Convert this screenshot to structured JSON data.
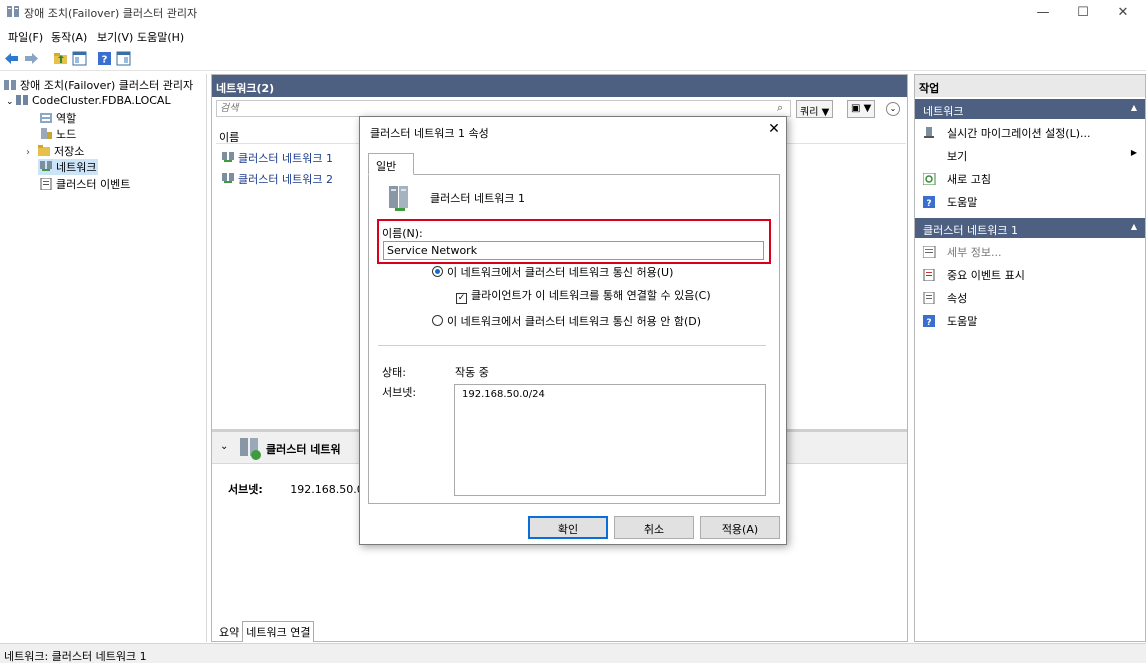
{
  "window": {
    "title": "장애 조치(Failover) 클러스터 관리자",
    "min_glyph": "—",
    "max_glyph": "☐",
    "close_glyph": "✕"
  },
  "menu": [
    "파일(F)",
    "동작(A)",
    "보기(V)",
    "도움말(H)"
  ],
  "tree": {
    "root": "장애 조치(Failover) 클러스터 관리자",
    "cluster": "CodeCluster.FDBA.LOCAL",
    "children": [
      "역할",
      "노드",
      "저장소",
      "네트워크",
      "클러스터 이벤트"
    ]
  },
  "center": {
    "header": "네트워크(2)",
    "search_placeholder": "검색",
    "query_label": "쿼리",
    "column_name": "이름",
    "rows": [
      "클러스터 네트워크 1",
      "클러스터 네트워크 2"
    ],
    "detail_title": "클러스터 네트워",
    "subnet_label": "서브넷:",
    "subnet_value": "192.168.50.0/",
    "tabs": [
      "요약",
      "네트워크 연결"
    ]
  },
  "actions": {
    "title": "작업",
    "section1": "네트워크",
    "section1_items": [
      "실시간 마이그레이션 설정(L)...",
      "보기",
      "새로 고침",
      "도움말"
    ],
    "section2": "클러스터 네트워크 1",
    "section2_items": [
      "세부 정보...",
      "중요 이벤트 표시",
      "속성",
      "도움말"
    ]
  },
  "status": {
    "text": "네트워크:  클러스터 네트워크 1"
  },
  "dialog": {
    "title": "클러스터 네트워크 1 속성",
    "tab": "일반",
    "network_name": "클러스터 네트워크 1",
    "name_label": "이름(N):",
    "name_value": "Service Network",
    "radio_allow": "이 네트워크에서 클러스터 네트워크 통신 허용(U)",
    "check_clients": "클라이언트가 이 네트워크를 통해 연결할 수 있음(C)",
    "radio_deny": "이 네트워크에서 클러스터 네트워크 통신 허용 안 함(D)",
    "state_label": "상태:",
    "state_value": "작동 중",
    "subnet_label": "서브넷:",
    "subnet_value": "192.168.50.0/24",
    "ok": "확인",
    "cancel": "취소",
    "apply": "적용(A)"
  },
  "colors": {
    "header_blue": "#4d6082",
    "highlight_red": "#d8001d",
    "accent_blue": "#0a6dd8"
  }
}
